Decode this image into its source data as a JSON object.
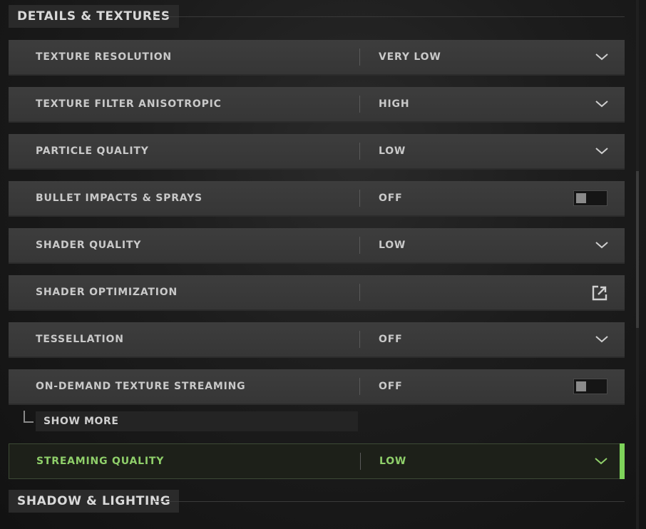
{
  "sections": {
    "details": {
      "title": "DETAILS & TEXTURES"
    },
    "shadow": {
      "title": "SHADOW & LIGHTING"
    }
  },
  "settings": [
    {
      "label": "TEXTURE RESOLUTION",
      "value": "VERY LOW",
      "control": "dropdown"
    },
    {
      "label": "TEXTURE FILTER ANISOTROPIC",
      "value": "HIGH",
      "control": "dropdown"
    },
    {
      "label": "PARTICLE QUALITY",
      "value": "LOW",
      "control": "dropdown"
    },
    {
      "label": "BULLET IMPACTS & SPRAYS",
      "value": "OFF",
      "control": "toggle"
    },
    {
      "label": "SHADER QUALITY",
      "value": "LOW",
      "control": "dropdown"
    },
    {
      "label": "SHADER OPTIMIZATION",
      "value": "",
      "control": "external-link"
    },
    {
      "label": "TESSELLATION",
      "value": "OFF",
      "control": "dropdown"
    },
    {
      "label": "ON-DEMAND TEXTURE STREAMING",
      "value": "OFF",
      "control": "toggle"
    }
  ],
  "show_more": {
    "label": "SHOW MORE"
  },
  "streaming_quality": {
    "label": "STREAMING QUALITY",
    "value": "LOW",
    "control": "dropdown",
    "active": true
  },
  "colors": {
    "accent": "#7ed35a",
    "text": "#c9c9c9",
    "row_background": "#3a3a3a"
  },
  "icons": {
    "dropdown": "chevron-down-icon",
    "toggle": "toggle-switch",
    "external": "external-link-icon",
    "tree": "tree-corner-icon"
  }
}
